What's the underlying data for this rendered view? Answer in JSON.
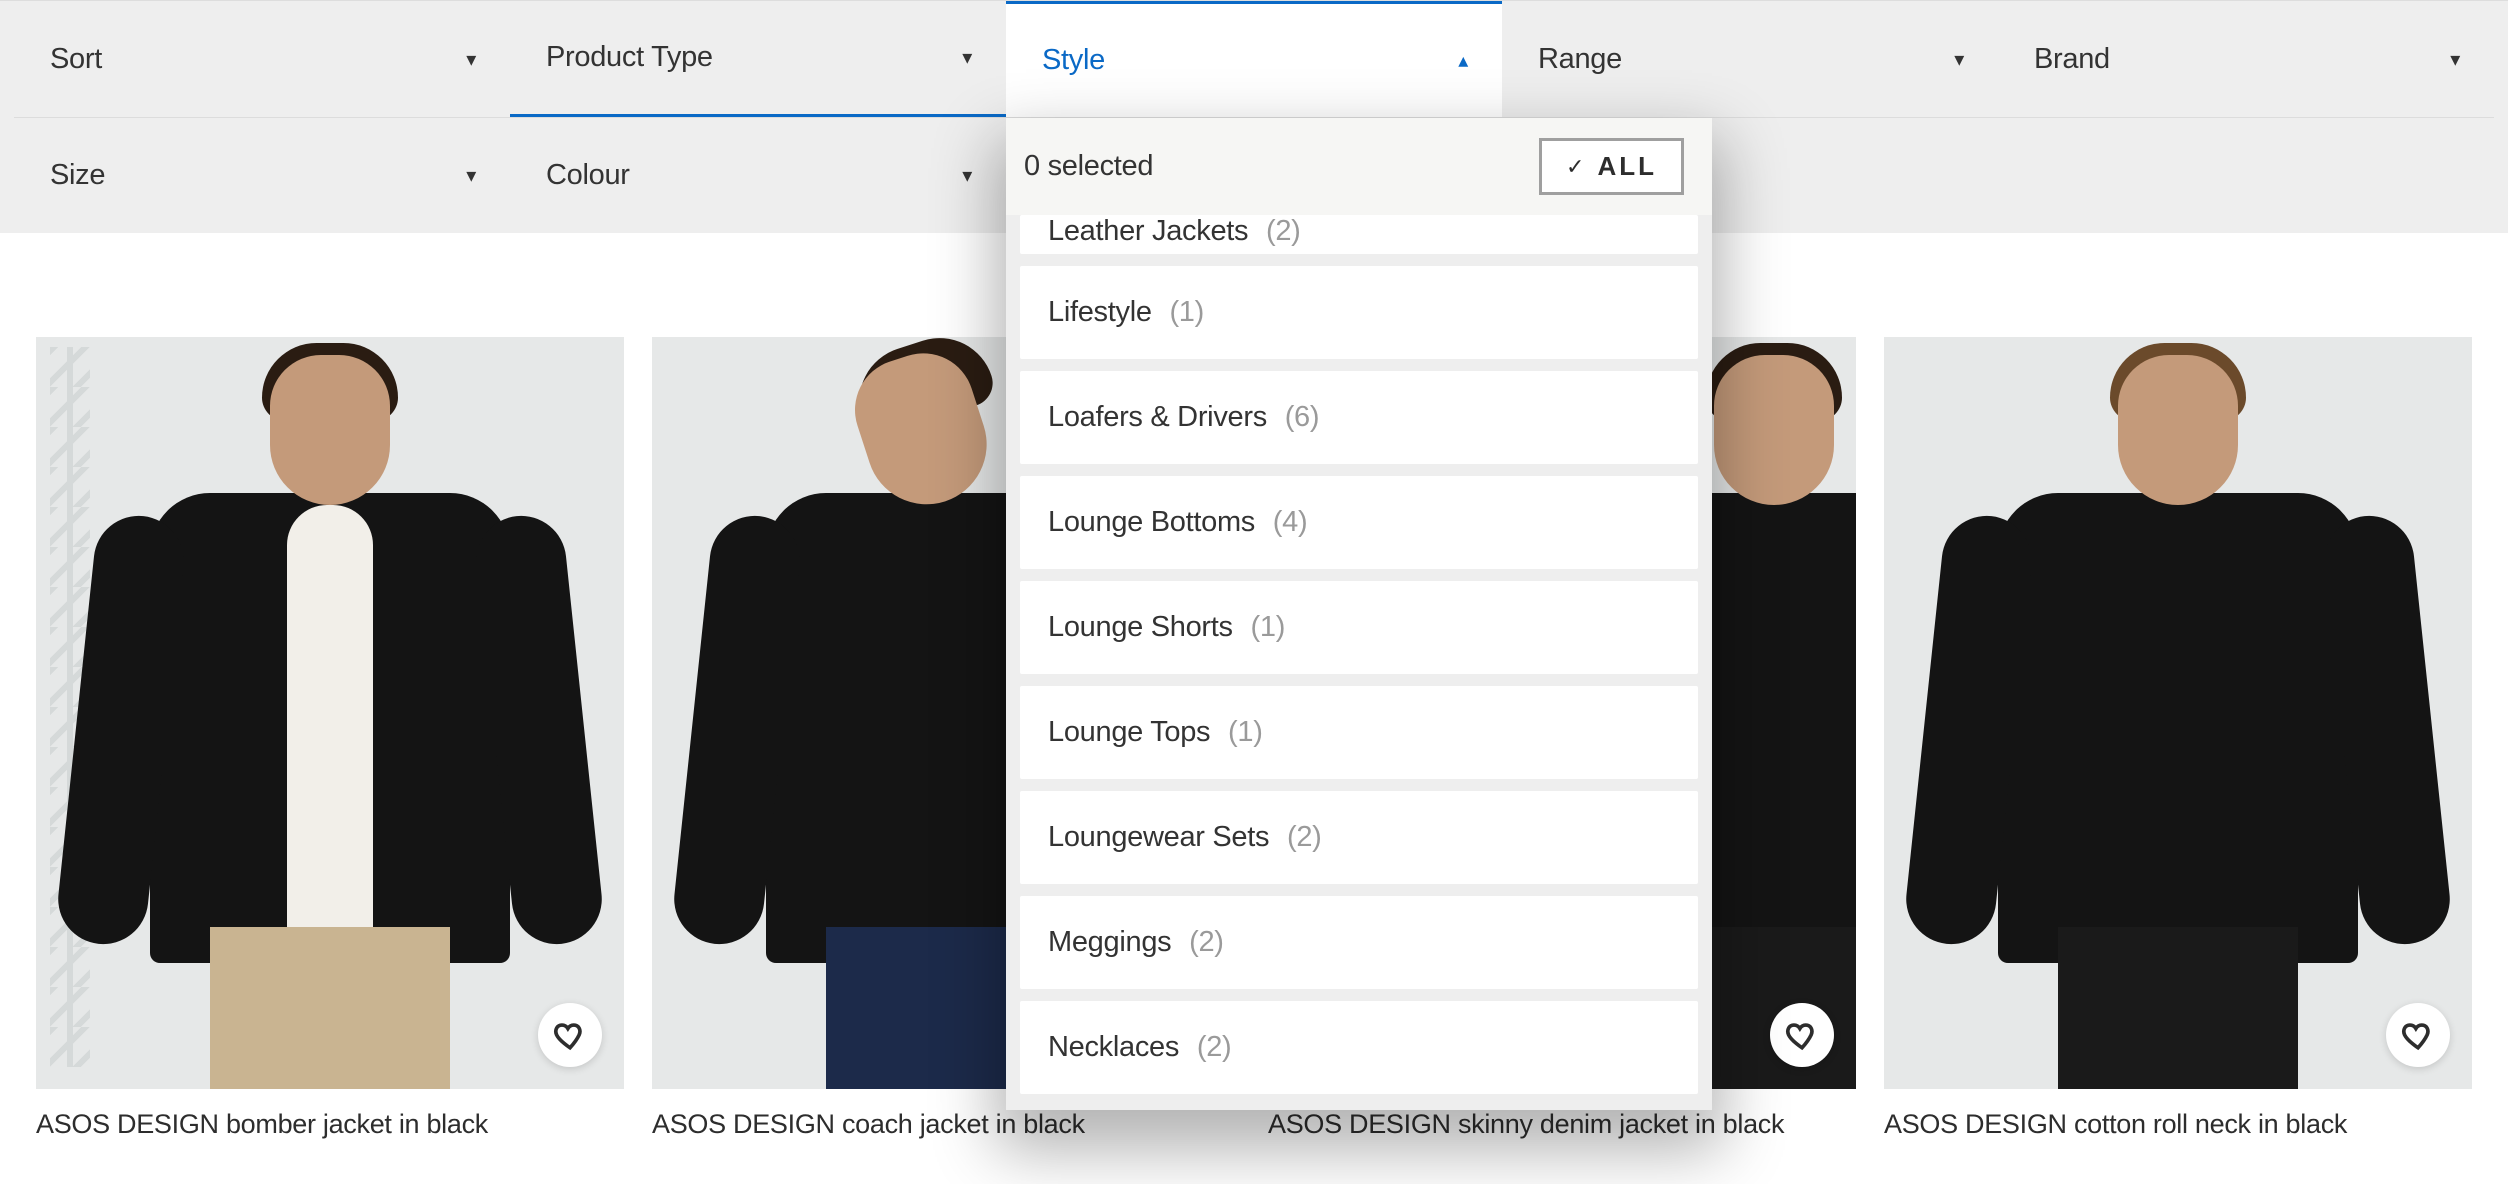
{
  "filters": {
    "row1": [
      {
        "label": "Sort"
      },
      {
        "label": "Product Type"
      },
      {
        "label": "Style"
      },
      {
        "label": "Range"
      },
      {
        "label": "Brand"
      }
    ],
    "row2": [
      {
        "label": "Size"
      },
      {
        "label": "Colour"
      }
    ]
  },
  "style_dropdown": {
    "selected_text": "0 selected",
    "all_label": "ALL",
    "options": [
      {
        "label": "Leather Jackets",
        "count": "(2)"
      },
      {
        "label": "Lifestyle",
        "count": "(1)"
      },
      {
        "label": "Loafers & Drivers",
        "count": "(6)"
      },
      {
        "label": "Lounge Bottoms",
        "count": "(4)"
      },
      {
        "label": "Lounge Shorts",
        "count": "(1)"
      },
      {
        "label": "Lounge Tops",
        "count": "(1)"
      },
      {
        "label": "Loungewear Sets",
        "count": "(2)"
      },
      {
        "label": "Meggings",
        "count": "(2)"
      },
      {
        "label": "Necklaces",
        "count": "(2)"
      }
    ]
  },
  "products": [
    {
      "title": "ASOS DESIGN bomber jacket in black"
    },
    {
      "title": "ASOS DESIGN coach jacket in black"
    },
    {
      "title": "ASOS DESIGN skinny denim jacket in black"
    },
    {
      "title": "ASOS DESIGN cotton roll neck in black"
    }
  ]
}
